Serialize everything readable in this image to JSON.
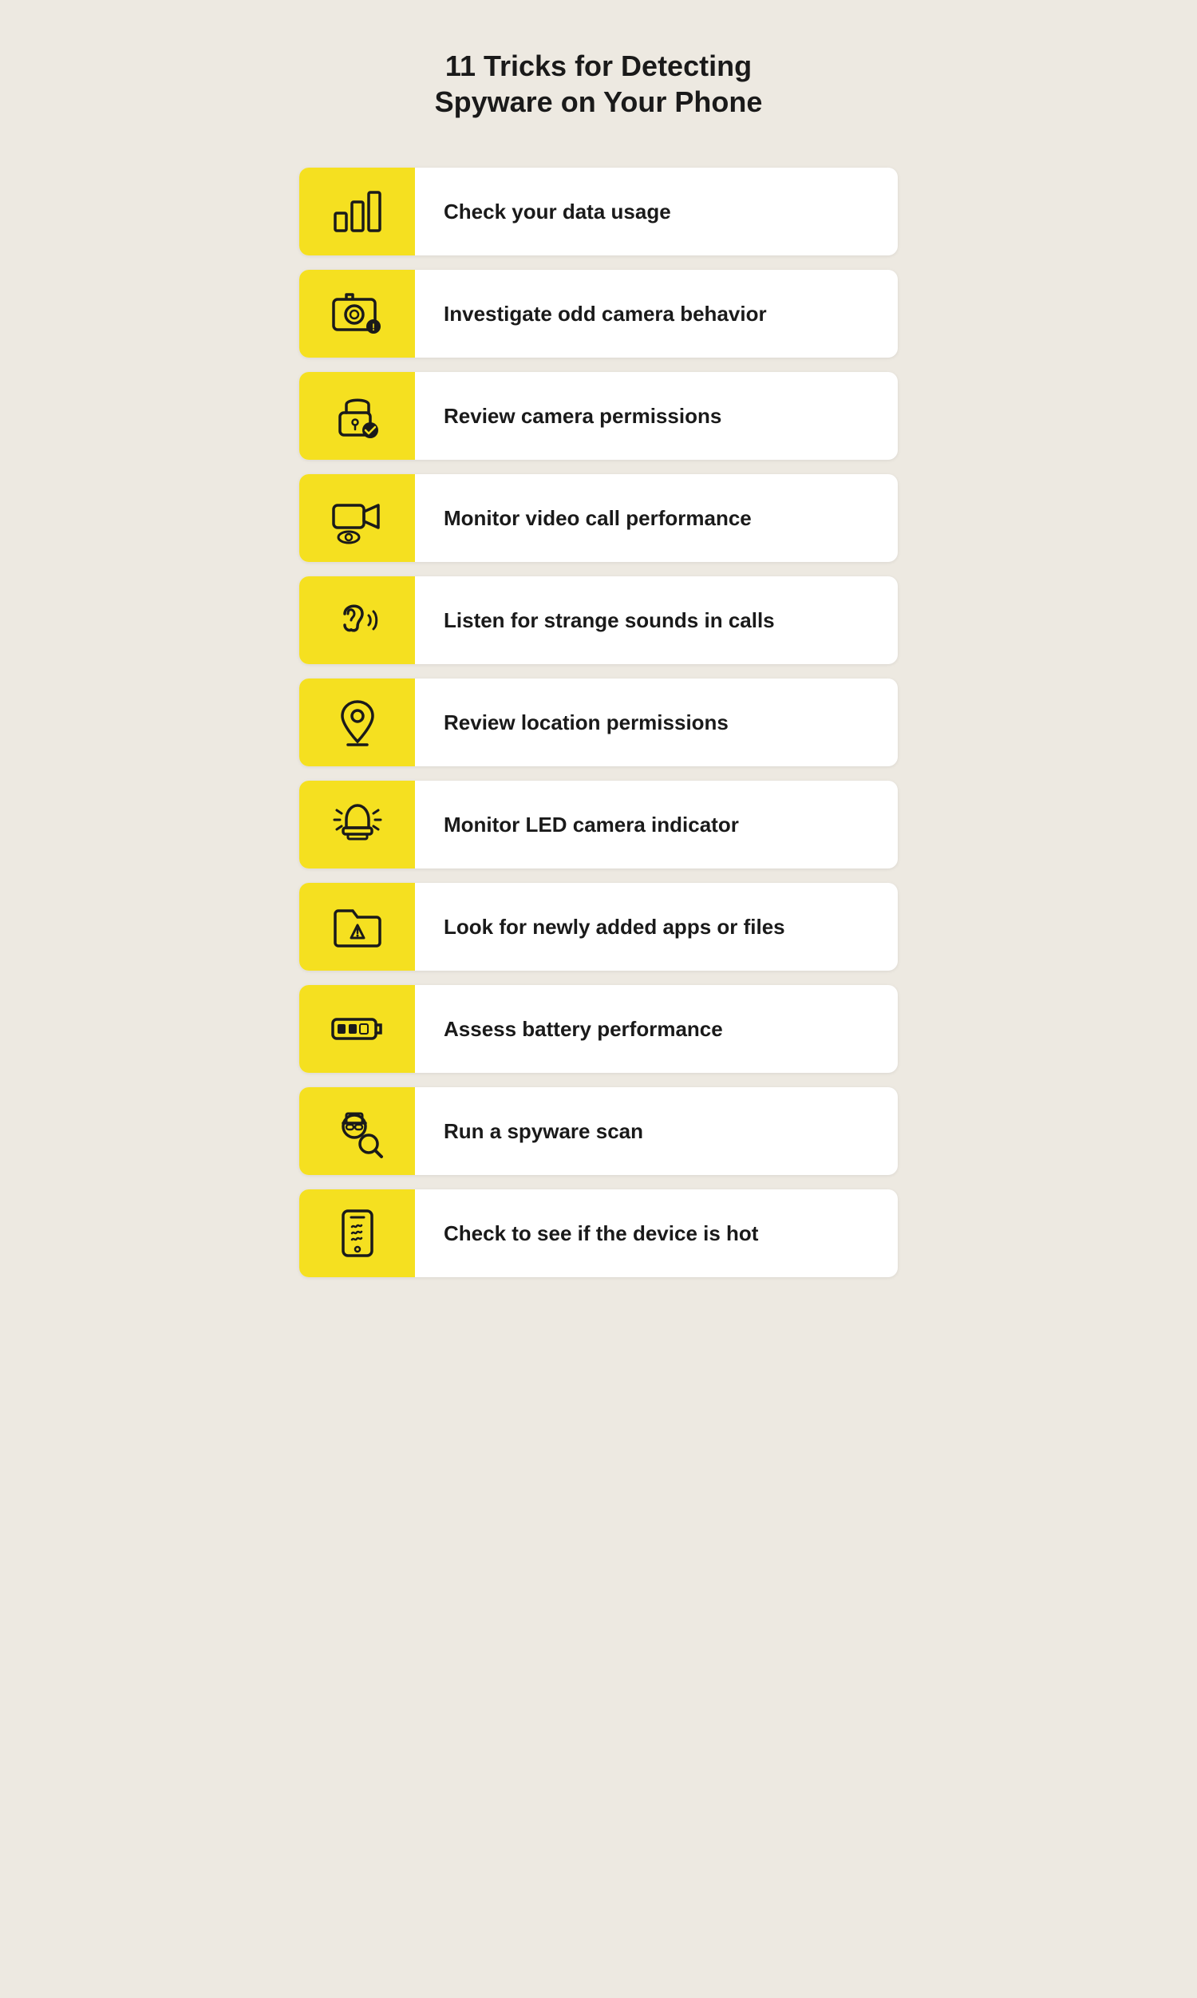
{
  "page": {
    "title_line1": "11 Tricks for Detecting",
    "title_line2": "Spyware on Your Phone",
    "accent_color": "#f5e020"
  },
  "items": [
    {
      "id": "data-usage",
      "label": "Check your data usage",
      "icon": "bar-chart"
    },
    {
      "id": "camera-behavior",
      "label": "Investigate odd camera behavior",
      "icon": "camera-alert"
    },
    {
      "id": "camera-permissions",
      "label": "Review camera permissions",
      "icon": "lock-check"
    },
    {
      "id": "video-call",
      "label": "Monitor video call performance",
      "icon": "video-eye"
    },
    {
      "id": "strange-sounds",
      "label": "Listen for strange sounds in calls",
      "icon": "ear-sound"
    },
    {
      "id": "location-permissions",
      "label": "Review location permissions",
      "icon": "location-pin"
    },
    {
      "id": "led-indicator",
      "label": "Monitor LED camera indicator",
      "icon": "alarm-light"
    },
    {
      "id": "new-apps",
      "label": "Look for newly added apps or files",
      "icon": "folder-warning"
    },
    {
      "id": "battery",
      "label": "Assess battery performance",
      "icon": "battery-low"
    },
    {
      "id": "spyware-scan",
      "label": "Run a spyware scan",
      "icon": "spy-search"
    },
    {
      "id": "device-hot",
      "label": "Check to see if the device is hot",
      "icon": "phone-hot"
    }
  ]
}
